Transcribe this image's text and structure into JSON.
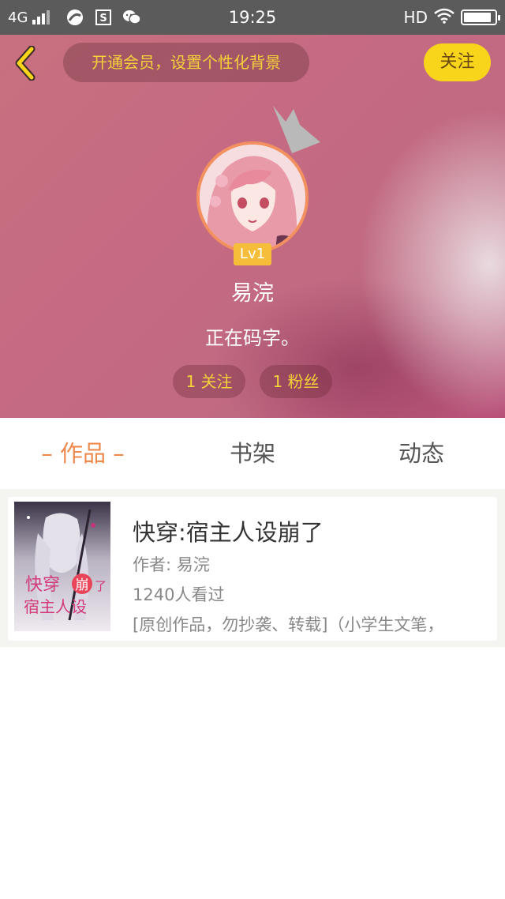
{
  "status_bar": {
    "network": "4G",
    "time": "19:25",
    "hd": "HD",
    "icons": [
      "signal-icon",
      "browser-icon",
      "s-app-icon",
      "wechat-icon",
      "wifi-icon",
      "battery-icon"
    ],
    "battery_level": 0.9
  },
  "header": {
    "back_icon": "back-arrow-icon",
    "promo": "开通会员，设置个性化背景",
    "follow_button": "关注",
    "level": "Lv1",
    "username": "易浣",
    "bio": "正在码字。",
    "stats": {
      "following": "1 关注",
      "fans": "1 粉丝"
    },
    "colors": {
      "accent_yellow": "#f8d41a",
      "promo_text": "#f5d13a",
      "avatar_border": "#f39060",
      "level_badge": "#f5bd3a"
    }
  },
  "tabs": [
    {
      "label": "– 作品 –",
      "active": true
    },
    {
      "label": "书架",
      "active": false
    },
    {
      "label": "动态",
      "active": false
    }
  ],
  "tab_active_color": "#ef8a4e",
  "works": [
    {
      "title": "快穿:宿主人设崩了",
      "author": "作者: 易浣",
      "views": "1240人看过",
      "description": "[原创作品，勿抄袭、转载]（小学生文笔，",
      "cover_text": [
        "快穿",
        "崩",
        "了",
        "宿主人设"
      ]
    }
  ]
}
